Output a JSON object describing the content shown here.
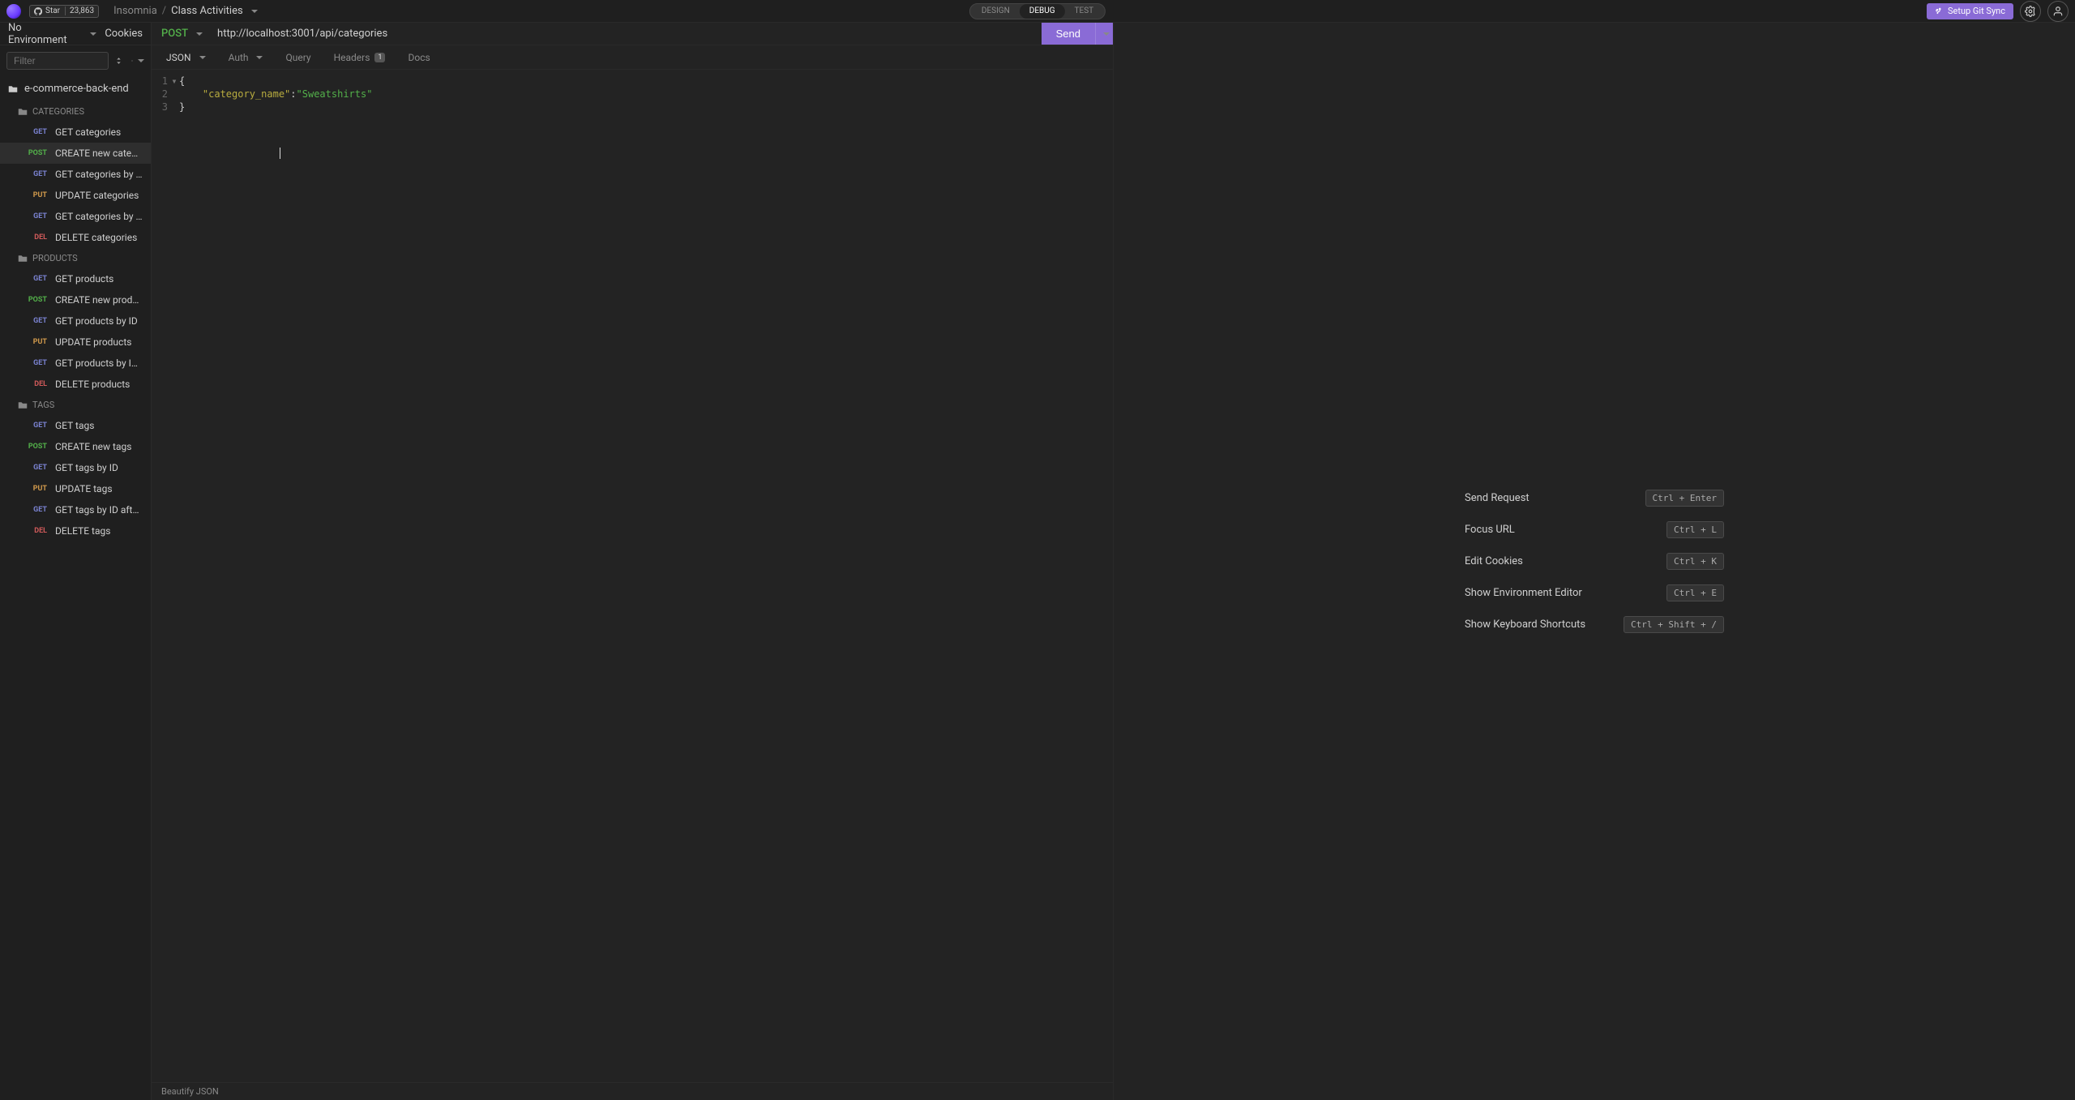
{
  "header": {
    "github_star_label": "Star",
    "github_star_count": "23,863",
    "breadcrumb_app": "Insomnia",
    "breadcrumb_project": "Class Activities",
    "tabs": {
      "design": "DESIGN",
      "debug": "DEBUG",
      "test": "TEST"
    },
    "git_sync": "Setup Git Sync"
  },
  "env": {
    "label": "No Environment",
    "cookies": "Cookies"
  },
  "sidebar": {
    "filter_placeholder": "Filter",
    "workspace": "e-commerce-back-end",
    "folders": [
      {
        "name": "CATEGORIES",
        "items": [
          {
            "method": "GET",
            "name": "GET categories"
          },
          {
            "method": "POST",
            "name": "CREATE new category",
            "selected": true
          },
          {
            "method": "GET",
            "name": "GET categories by ID"
          },
          {
            "method": "PUT",
            "name": "UPDATE categories"
          },
          {
            "method": "GET",
            "name": "GET categories by ID after P..."
          },
          {
            "method": "DEL",
            "name": "DELETE categories"
          }
        ]
      },
      {
        "name": "PRODUCTS",
        "items": [
          {
            "method": "GET",
            "name": "GET products"
          },
          {
            "method": "POST",
            "name": "CREATE new products"
          },
          {
            "method": "GET",
            "name": "GET products by ID"
          },
          {
            "method": "PUT",
            "name": "UPDATE products"
          },
          {
            "method": "GET",
            "name": "GET products by ID after PUT"
          },
          {
            "method": "DEL",
            "name": "DELETE products"
          }
        ]
      },
      {
        "name": "TAGS",
        "items": [
          {
            "method": "GET",
            "name": "GET tags"
          },
          {
            "method": "POST",
            "name": "CREATE new tags"
          },
          {
            "method": "GET",
            "name": "GET tags by ID"
          },
          {
            "method": "PUT",
            "name": "UPDATE tags"
          },
          {
            "method": "GET",
            "name": "GET tags by ID after PUT"
          },
          {
            "method": "DEL",
            "name": "DELETE tags"
          }
        ]
      }
    ]
  },
  "request": {
    "method": "POST",
    "url": "http://localhost:3001/api/categories",
    "send": "Send",
    "tabs": {
      "body": "JSON",
      "auth": "Auth",
      "query": "Query",
      "headers": "Headers",
      "headers_count": "1",
      "docs": "Docs"
    },
    "body_lines": [
      "{",
      "    \"category_name\":\"Sweatshirts\"",
      "}"
    ],
    "body_json": {
      "category_name": "Sweatshirts"
    },
    "beautify": "Beautify JSON"
  },
  "hints": [
    {
      "label": "Send Request",
      "kbd": "Ctrl + Enter"
    },
    {
      "label": "Focus URL",
      "kbd": "Ctrl + L"
    },
    {
      "label": "Edit Cookies",
      "kbd": "Ctrl + K"
    },
    {
      "label": "Show Environment Editor",
      "kbd": "Ctrl + E"
    },
    {
      "label": "Show Keyboard Shortcuts",
      "kbd": "Ctrl + Shift + /"
    }
  ]
}
